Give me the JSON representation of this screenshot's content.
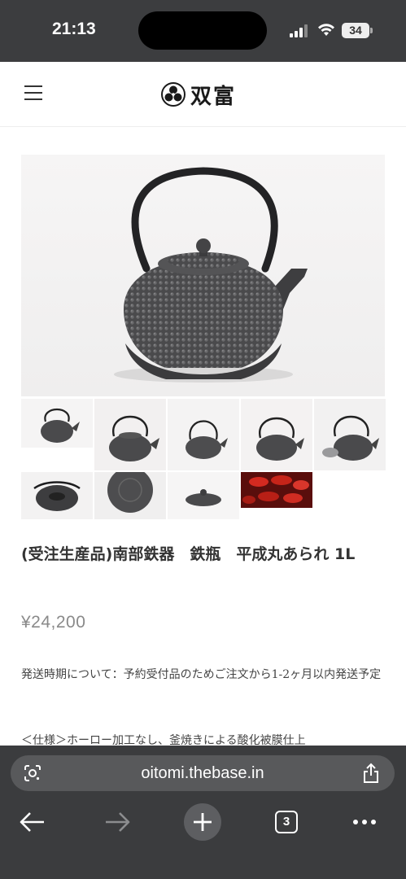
{
  "status": {
    "time": "21:13",
    "battery": "34"
  },
  "header": {
    "logo_text": "双富"
  },
  "product": {
    "title": "(受注生産品)南部鉄器　鉄瓶　平成丸あられ 1L",
    "price": "¥24,200",
    "shipping_note": "発送時期について：予約受付品のためご注文から1-2ヶ月以内発送予定",
    "spec": "＜仕様＞ホーロー加工なし、釜焼きによる酸化被膜仕上"
  },
  "browser": {
    "url": "oitomi.thebase.in",
    "tab_count": "3"
  },
  "icons": {
    "menu": "hamburger-menu-icon",
    "lens": "google-lens-icon",
    "share": "share-icon",
    "back": "back-arrow-icon",
    "forward": "forward-arrow-icon",
    "new_tab": "plus-icon",
    "more": "more-dots-icon"
  },
  "colors": {
    "status_bar": "#3c3d3f",
    "browser_bar": "#3b3c3e",
    "url_pill": "#58595b",
    "price": "#8a8a8a"
  }
}
